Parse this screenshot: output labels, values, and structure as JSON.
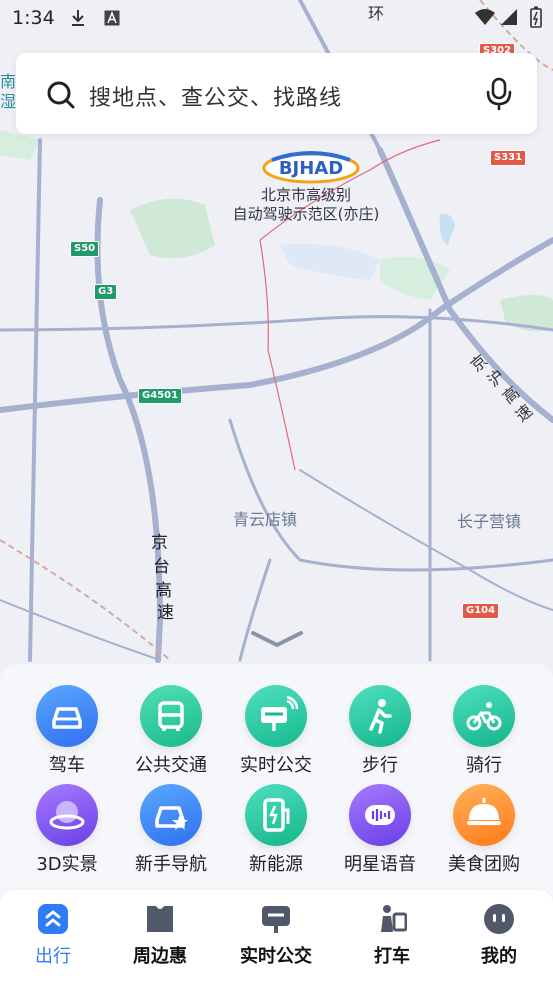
{
  "status_bar": {
    "time": "1:34"
  },
  "search": {
    "placeholder": "搜地点、查公交、找路线"
  },
  "map": {
    "logo_text": "BJHAD",
    "zone_title_line1": "北京市高级别",
    "zone_title_line2": "自动驾驶示范区(亦庄)",
    "places": {
      "qingyundian": "青云店镇",
      "changziying": "长子营镇"
    },
    "roads": {
      "jinghu_1": "京",
      "jinghu_2": "沪",
      "jinghu_3": "高",
      "jinghu_4": "速",
      "jingtai_1": "京",
      "jingtai_2": "台",
      "jingtai_3": "高",
      "jingtai_4": "速",
      "top_ring": "环"
    },
    "shields": {
      "s50": "S50",
      "g3": "G3",
      "g4501": "G4501",
      "s331": "S331",
      "s302": "S302",
      "g104": "G104"
    },
    "edge_labels": {
      "south_1": "南",
      "south_2": "湿"
    }
  },
  "services": [
    {
      "label": "驾车",
      "icon": "car-icon"
    },
    {
      "label": "公共交通",
      "icon": "bus-icon"
    },
    {
      "label": "实时公交",
      "icon": "realtime-bus-icon"
    },
    {
      "label": "步行",
      "icon": "walk-icon"
    },
    {
      "label": "骑行",
      "icon": "bike-icon"
    },
    {
      "label": "3D实景",
      "icon": "globe-3d-icon"
    },
    {
      "label": "新手导航",
      "icon": "novice-nav-icon"
    },
    {
      "label": "新能源",
      "icon": "ev-charger-icon"
    },
    {
      "label": "明星语音",
      "icon": "voice-icon"
    },
    {
      "label": "美食团购",
      "icon": "food-icon"
    }
  ],
  "tabs": [
    {
      "label": "出行",
      "active": true
    },
    {
      "label": "周边惠",
      "active": false
    },
    {
      "label": "实时公交",
      "active": false
    },
    {
      "label": "打车",
      "active": false
    },
    {
      "label": "我的",
      "active": false
    }
  ],
  "colors": {
    "accent": "#2f7cf6",
    "road": "#9ea9c9",
    "green_area": "#cde8d5"
  }
}
